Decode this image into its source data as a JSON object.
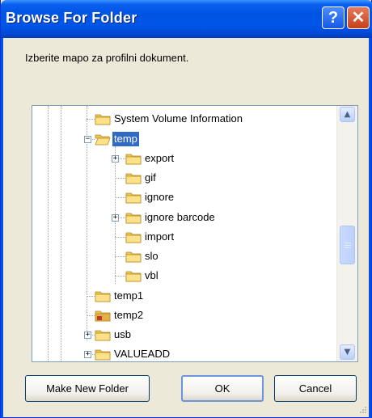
{
  "window": {
    "title": "Browse For Folder"
  },
  "title_buttons": {
    "help": "?",
    "close": "✕"
  },
  "instruction": "Izberite mapo za profilni dokument.",
  "tree": {
    "items": [
      {
        "label": "System Volume Information",
        "icon": "folder-icon",
        "expander": "",
        "selected": false
      },
      {
        "label": "temp",
        "icon": "folder-open-icon",
        "expander": "−",
        "selected": true
      },
      {
        "label": "export",
        "icon": "folder-icon",
        "expander": "+",
        "selected": false
      },
      {
        "label": "gif",
        "icon": "folder-icon",
        "expander": "",
        "selected": false
      },
      {
        "label": "ignore",
        "icon": "folder-icon",
        "expander": "",
        "selected": false
      },
      {
        "label": "ignore barcode",
        "icon": "folder-icon",
        "expander": "+",
        "selected": false
      },
      {
        "label": "import",
        "icon": "folder-icon",
        "expander": "",
        "selected": false
      },
      {
        "label": "slo",
        "icon": "folder-icon",
        "expander": "",
        "selected": false
      },
      {
        "label": "vbl",
        "icon": "folder-icon",
        "expander": "",
        "selected": false
      },
      {
        "label": "temp1",
        "icon": "folder-icon",
        "expander": "",
        "selected": false
      },
      {
        "label": "temp2",
        "icon": "folder-special-icon",
        "expander": "",
        "selected": false
      },
      {
        "label": "usb",
        "icon": "folder-icon",
        "expander": "+",
        "selected": false
      },
      {
        "label": "VALUEADD",
        "icon": "folder-icon",
        "expander": "+",
        "selected": false
      }
    ]
  },
  "scrollbar": {
    "up": "▲",
    "down": "▼"
  },
  "buttons": {
    "new_folder": "Make New Folder",
    "ok": "OK",
    "cancel": "Cancel"
  },
  "colors": {
    "title_bar": "#0054E3",
    "selection": "#316AC5",
    "dialog_bg": "#ECE9D8",
    "close": "#C5411B"
  }
}
